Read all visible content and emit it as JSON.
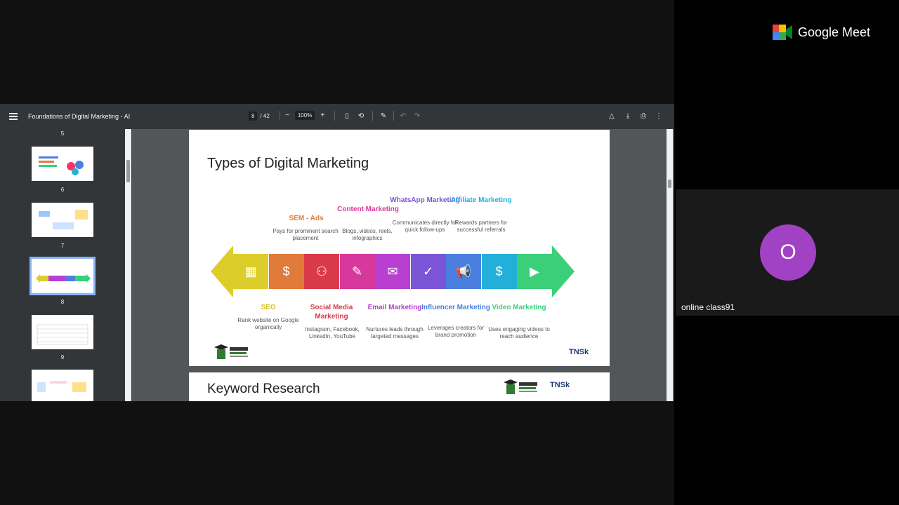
{
  "app": {
    "brand": "Google Meet"
  },
  "pdf": {
    "title": "Foundations of Digital Marketing - AI",
    "current_page": "8",
    "total_pages": "/ 42",
    "zoom": "100%",
    "zoom_out": "−",
    "zoom_in": "+"
  },
  "thumbnails": [
    {
      "num": "5"
    },
    {
      "num": "6"
    },
    {
      "num": "7"
    },
    {
      "num": "8"
    },
    {
      "num": "9"
    }
  ],
  "slide": {
    "title": "Types of Digital Marketing",
    "top_items": [
      {
        "label": "SEM - Ads",
        "desc": "Pays for prominent search placement",
        "color": "#e07b39"
      },
      {
        "label": "Content Marketing",
        "desc": "Blogs, videos, reels, infographics",
        "color": "#d6399b"
      },
      {
        "label": "WhatsApp Marketing",
        "desc": "Communicates directly for quick follow-ups",
        "color": "#7b55d6"
      },
      {
        "label": "Affiliate Marketing",
        "desc": "Rewards partners for successful referrals",
        "color": "#23b0d8"
      }
    ],
    "bottom_items": [
      {
        "label": "SEO",
        "desc": "Rank website on Google organically",
        "color": "#d5c21a"
      },
      {
        "label": "Social Media Marketing",
        "desc": "Instagram, Facebook, LinkedIn, YouTube",
        "color": "#d93a49"
      },
      {
        "label": "Email Marketing",
        "desc": "Nurtures leads through targeted messages",
        "color": "#b83fd0"
      },
      {
        "label": "Influencer Marketing",
        "desc": "Leverages creators for brand promotion",
        "color": "#4a7fe0"
      },
      {
        "label": "Video Marketing",
        "desc": "Uses engaging videos to reach audience",
        "color": "#3bcf7a"
      }
    ],
    "tiles": [
      {
        "icon": "▦",
        "color": "#dccd2a"
      },
      {
        "icon": "$",
        "color": "#e07b39"
      },
      {
        "icon": "⚇",
        "color": "#d93a49"
      },
      {
        "icon": "✎",
        "color": "#d6399b"
      },
      {
        "icon": "✉",
        "color": "#b83fd0"
      },
      {
        "icon": "✓",
        "color": "#7b55d6"
      },
      {
        "icon": "📢",
        "color": "#4a7fe0"
      },
      {
        "icon": "$",
        "color": "#23b0d8"
      },
      {
        "icon": "▶",
        "color": "#3bcf7a"
      }
    ],
    "logo_right": "TNSk"
  },
  "slide2": {
    "title": "Keyword Research",
    "logo_right": "TNSk"
  },
  "participant": {
    "name": "online class91",
    "initial": "O",
    "avatar_color": "#a142c4"
  }
}
